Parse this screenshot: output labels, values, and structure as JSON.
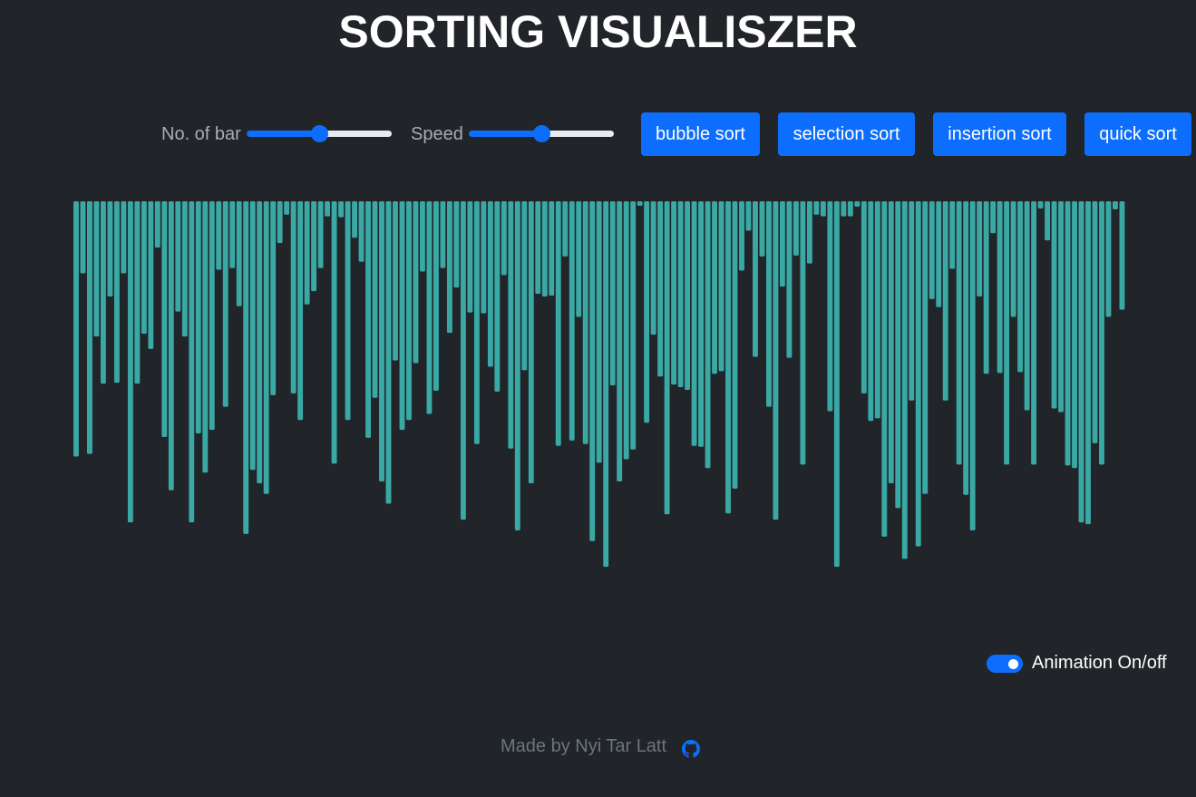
{
  "header": {
    "title": "SORTING VISUALISZER"
  },
  "controls": {
    "bars_label": "No. of bar",
    "bars_value": 0.5,
    "speed_label": "Speed",
    "speed_value": 0.5,
    "buttons": [
      "bubble sort",
      "selection sort",
      "insertion sort",
      "quick sort"
    ]
  },
  "colors": {
    "bar": "#3aa8a4",
    "accent": "#0d6efd",
    "background": "#212428"
  },
  "chart_data": {
    "type": "bar",
    "values": [
      287,
      81,
      284,
      152,
      205,
      107,
      204,
      81,
      361,
      205,
      149,
      166,
      52,
      265,
      325,
      124,
      152,
      361,
      261,
      305,
      257,
      77,
      231,
      75,
      118,
      374,
      302,
      317,
      329,
      218,
      47,
      15,
      216,
      246,
      116,
      101,
      75,
      17,
      295,
      18,
      246,
      41,
      68,
      266,
      221,
      315,
      340,
      179,
      257,
      246,
      182,
      79,
      239,
      213,
      75,
      148,
      97,
      358,
      125,
      273,
      126,
      186,
      214,
      83,
      278,
      370,
      190,
      317,
      104,
      107,
      106,
      275,
      62,
      269,
      130,
      273,
      382,
      294,
      411,
      207,
      315,
      290,
      279,
      5,
      249,
      150,
      197,
      352,
      206,
      209,
      212,
      275,
      276,
      300,
      194,
      191,
      351,
      323,
      78,
      33,
      175,
      62,
      231,
      358,
      96,
      176,
      61,
      296,
      70,
      15,
      17,
      236,
      411,
      17,
      17,
      6,
      216,
      247,
      244,
      377,
      317,
      345,
      402,
      224,
      388,
      329,
      110,
      119,
      224,
      76,
      296,
      330,
      370,
      107,
      194,
      36,
      193,
      296,
      130,
      192,
      235,
      296,
      8,
      44,
      233,
      237,
      297,
      300,
      361,
      363,
      272,
      296,
      130,
      9,
      122
    ],
    "ylim": [
      0,
      420
    ]
  },
  "toggle": {
    "label": "Animation On/off",
    "on": true
  },
  "footer": {
    "text": "Made by Nyi Tar Latt"
  }
}
